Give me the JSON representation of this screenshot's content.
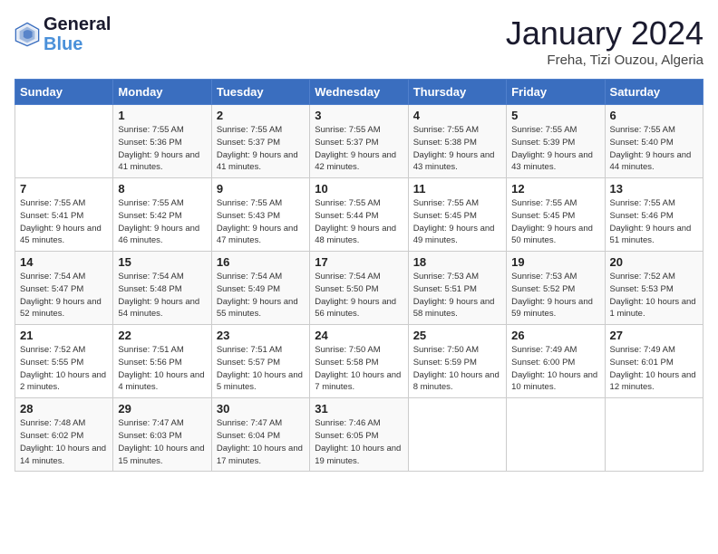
{
  "header": {
    "logo_general": "General",
    "logo_blue": "Blue",
    "month_title": "January 2024",
    "subtitle": "Freha, Tizi Ouzou, Algeria"
  },
  "weekdays": [
    "Sunday",
    "Monday",
    "Tuesday",
    "Wednesday",
    "Thursday",
    "Friday",
    "Saturday"
  ],
  "weeks": [
    [
      {
        "day": "",
        "sunrise": "",
        "sunset": "",
        "daylight": ""
      },
      {
        "day": "1",
        "sunrise": "Sunrise: 7:55 AM",
        "sunset": "Sunset: 5:36 PM",
        "daylight": "Daylight: 9 hours and 41 minutes."
      },
      {
        "day": "2",
        "sunrise": "Sunrise: 7:55 AM",
        "sunset": "Sunset: 5:37 PM",
        "daylight": "Daylight: 9 hours and 41 minutes."
      },
      {
        "day": "3",
        "sunrise": "Sunrise: 7:55 AM",
        "sunset": "Sunset: 5:37 PM",
        "daylight": "Daylight: 9 hours and 42 minutes."
      },
      {
        "day": "4",
        "sunrise": "Sunrise: 7:55 AM",
        "sunset": "Sunset: 5:38 PM",
        "daylight": "Daylight: 9 hours and 43 minutes."
      },
      {
        "day": "5",
        "sunrise": "Sunrise: 7:55 AM",
        "sunset": "Sunset: 5:39 PM",
        "daylight": "Daylight: 9 hours and 43 minutes."
      },
      {
        "day": "6",
        "sunrise": "Sunrise: 7:55 AM",
        "sunset": "Sunset: 5:40 PM",
        "daylight": "Daylight: 9 hours and 44 minutes."
      }
    ],
    [
      {
        "day": "7",
        "sunrise": "Sunrise: 7:55 AM",
        "sunset": "Sunset: 5:41 PM",
        "daylight": "Daylight: 9 hours and 45 minutes."
      },
      {
        "day": "8",
        "sunrise": "Sunrise: 7:55 AM",
        "sunset": "Sunset: 5:42 PM",
        "daylight": "Daylight: 9 hours and 46 minutes."
      },
      {
        "day": "9",
        "sunrise": "Sunrise: 7:55 AM",
        "sunset": "Sunset: 5:43 PM",
        "daylight": "Daylight: 9 hours and 47 minutes."
      },
      {
        "day": "10",
        "sunrise": "Sunrise: 7:55 AM",
        "sunset": "Sunset: 5:44 PM",
        "daylight": "Daylight: 9 hours and 48 minutes."
      },
      {
        "day": "11",
        "sunrise": "Sunrise: 7:55 AM",
        "sunset": "Sunset: 5:45 PM",
        "daylight": "Daylight: 9 hours and 49 minutes."
      },
      {
        "day": "12",
        "sunrise": "Sunrise: 7:55 AM",
        "sunset": "Sunset: 5:45 PM",
        "daylight": "Daylight: 9 hours and 50 minutes."
      },
      {
        "day": "13",
        "sunrise": "Sunrise: 7:55 AM",
        "sunset": "Sunset: 5:46 PM",
        "daylight": "Daylight: 9 hours and 51 minutes."
      }
    ],
    [
      {
        "day": "14",
        "sunrise": "Sunrise: 7:54 AM",
        "sunset": "Sunset: 5:47 PM",
        "daylight": "Daylight: 9 hours and 52 minutes."
      },
      {
        "day": "15",
        "sunrise": "Sunrise: 7:54 AM",
        "sunset": "Sunset: 5:48 PM",
        "daylight": "Daylight: 9 hours and 54 minutes."
      },
      {
        "day": "16",
        "sunrise": "Sunrise: 7:54 AM",
        "sunset": "Sunset: 5:49 PM",
        "daylight": "Daylight: 9 hours and 55 minutes."
      },
      {
        "day": "17",
        "sunrise": "Sunrise: 7:54 AM",
        "sunset": "Sunset: 5:50 PM",
        "daylight": "Daylight: 9 hours and 56 minutes."
      },
      {
        "day": "18",
        "sunrise": "Sunrise: 7:53 AM",
        "sunset": "Sunset: 5:51 PM",
        "daylight": "Daylight: 9 hours and 58 minutes."
      },
      {
        "day": "19",
        "sunrise": "Sunrise: 7:53 AM",
        "sunset": "Sunset: 5:52 PM",
        "daylight": "Daylight: 9 hours and 59 minutes."
      },
      {
        "day": "20",
        "sunrise": "Sunrise: 7:52 AM",
        "sunset": "Sunset: 5:53 PM",
        "daylight": "Daylight: 10 hours and 1 minute."
      }
    ],
    [
      {
        "day": "21",
        "sunrise": "Sunrise: 7:52 AM",
        "sunset": "Sunset: 5:55 PM",
        "daylight": "Daylight: 10 hours and 2 minutes."
      },
      {
        "day": "22",
        "sunrise": "Sunrise: 7:51 AM",
        "sunset": "Sunset: 5:56 PM",
        "daylight": "Daylight: 10 hours and 4 minutes."
      },
      {
        "day": "23",
        "sunrise": "Sunrise: 7:51 AM",
        "sunset": "Sunset: 5:57 PM",
        "daylight": "Daylight: 10 hours and 5 minutes."
      },
      {
        "day": "24",
        "sunrise": "Sunrise: 7:50 AM",
        "sunset": "Sunset: 5:58 PM",
        "daylight": "Daylight: 10 hours and 7 minutes."
      },
      {
        "day": "25",
        "sunrise": "Sunrise: 7:50 AM",
        "sunset": "Sunset: 5:59 PM",
        "daylight": "Daylight: 10 hours and 8 minutes."
      },
      {
        "day": "26",
        "sunrise": "Sunrise: 7:49 AM",
        "sunset": "Sunset: 6:00 PM",
        "daylight": "Daylight: 10 hours and 10 minutes."
      },
      {
        "day": "27",
        "sunrise": "Sunrise: 7:49 AM",
        "sunset": "Sunset: 6:01 PM",
        "daylight": "Daylight: 10 hours and 12 minutes."
      }
    ],
    [
      {
        "day": "28",
        "sunrise": "Sunrise: 7:48 AM",
        "sunset": "Sunset: 6:02 PM",
        "daylight": "Daylight: 10 hours and 14 minutes."
      },
      {
        "day": "29",
        "sunrise": "Sunrise: 7:47 AM",
        "sunset": "Sunset: 6:03 PM",
        "daylight": "Daylight: 10 hours and 15 minutes."
      },
      {
        "day": "30",
        "sunrise": "Sunrise: 7:47 AM",
        "sunset": "Sunset: 6:04 PM",
        "daylight": "Daylight: 10 hours and 17 minutes."
      },
      {
        "day": "31",
        "sunrise": "Sunrise: 7:46 AM",
        "sunset": "Sunset: 6:05 PM",
        "daylight": "Daylight: 10 hours and 19 minutes."
      },
      {
        "day": "",
        "sunrise": "",
        "sunset": "",
        "daylight": ""
      },
      {
        "day": "",
        "sunrise": "",
        "sunset": "",
        "daylight": ""
      },
      {
        "day": "",
        "sunrise": "",
        "sunset": "",
        "daylight": ""
      }
    ]
  ]
}
